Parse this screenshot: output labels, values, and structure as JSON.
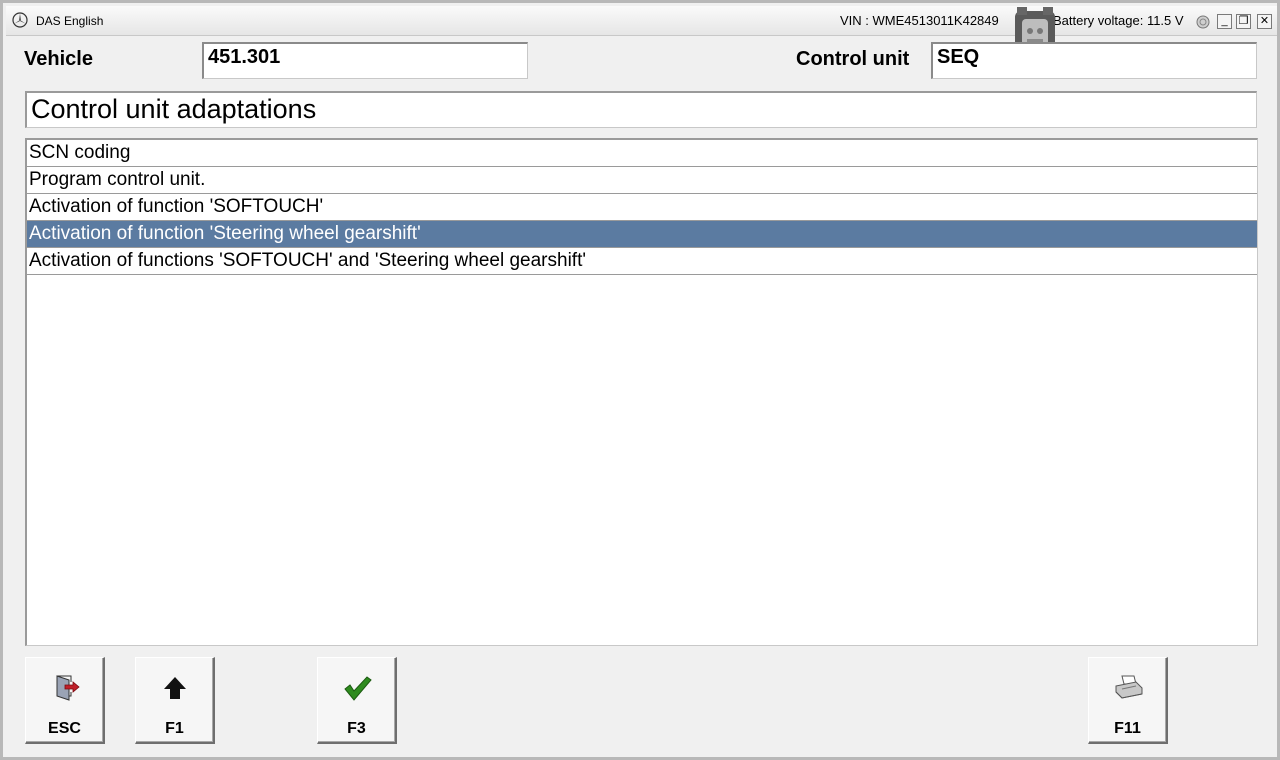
{
  "titlebar": {
    "app_title": "DAS English",
    "vin": "VIN : WME4513011K42849",
    "battery": "Battery voltage: 11.5 V",
    "minimize": "_",
    "restore": "❐",
    "close": "✕"
  },
  "header": {
    "vehicle_label": "Vehicle",
    "vehicle_value": "451.301",
    "control_unit_label": "Control unit",
    "control_unit_value": "SEQ"
  },
  "section_title": "Control unit adaptations",
  "list": {
    "items": [
      "SCN coding",
      "Program control unit.",
      "Activation of function 'SOFTOUCH'",
      "Activation of function 'Steering wheel gearshift'",
      "Activation of functions 'SOFTOUCH' and 'Steering wheel gearshift'"
    ],
    "selected_index": 3
  },
  "buttons": {
    "esc": "ESC",
    "f1": "F1",
    "f3": "F3",
    "f11": "F11"
  },
  "colors": {
    "selection": "#5b7ba1",
    "check": "#2e8b1e",
    "accent_red": "#c0202a"
  },
  "icons": {
    "esc": "exit-door-icon",
    "f1": "up-arrow-icon",
    "f3": "checkmark-icon",
    "f11": "printer-icon"
  }
}
